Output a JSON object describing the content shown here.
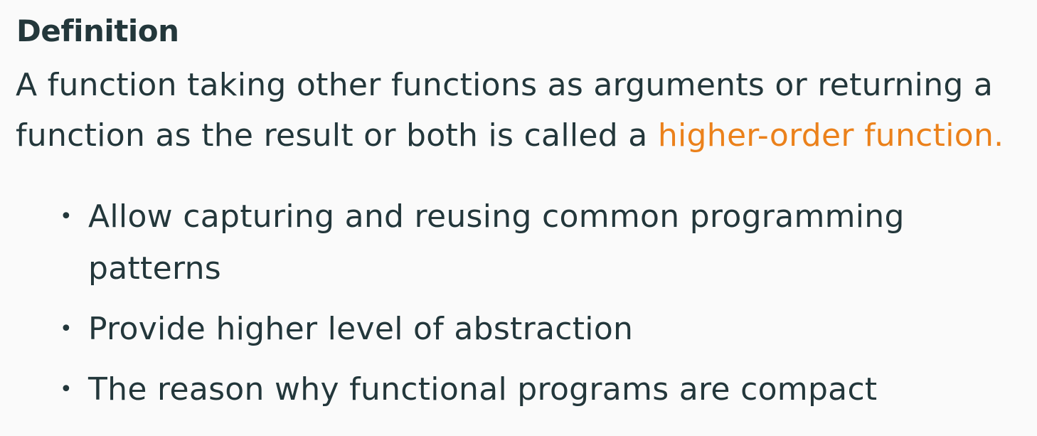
{
  "block": {
    "title": "Definition",
    "body_line1": "A function taking other functions as arguments or returning a",
    "body_line2_prefix": "function as the result or both is called a ",
    "body_highlight": "higher-order function."
  },
  "bullets": {
    "item1_line1": "Allow capturing and reusing common programming",
    "item1_line2": "patterns",
    "item2": "Provide higher level of abstraction",
    "item3": "The reason why functional programs are compact",
    "marker": "•"
  },
  "colors": {
    "text": "#23373b",
    "accent": "#eb811b",
    "background": "#fafafa"
  }
}
